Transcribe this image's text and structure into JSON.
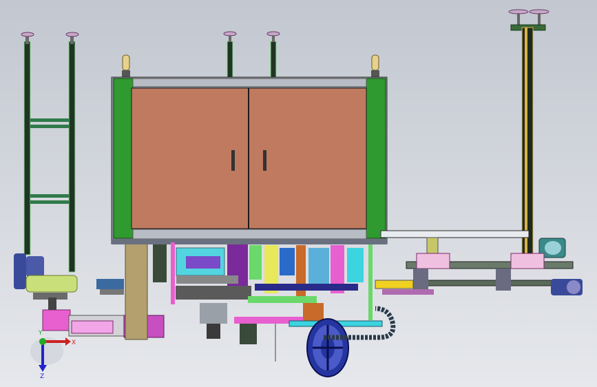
{
  "viewport": {
    "background_top": "#c2c7d0",
    "background_bottom": "#e6e8ec"
  },
  "model": {
    "description_icon": "cad-machine-assembly",
    "colors": {
      "frame_green": "#2f9a2f",
      "cabinet_door": "#c07a60",
      "column_dark": "#1f3524",
      "column_tan": "#b3a06e",
      "pink": "#e85fcf",
      "blue_wheel": "#2535a0",
      "cyan": "#3bd4e0",
      "motor_blue": "#3a4a9a"
    }
  },
  "triad": {
    "x_label": "X",
    "y_label": "Y",
    "z_label": "Z"
  }
}
